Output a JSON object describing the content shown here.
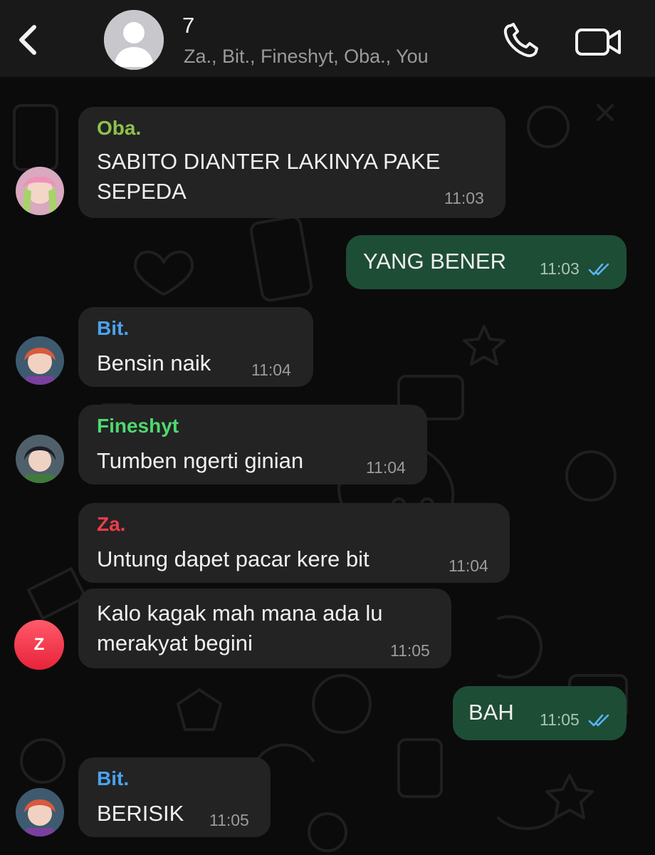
{
  "header": {
    "group_name": "7",
    "members": "Za., Bit., Fineshyt, Oba., You"
  },
  "colors": {
    "incoming_bubble": "#232323",
    "outgoing_bubble": "#1e4d36",
    "oba": "#8fc24a",
    "bit": "#4aa3f0",
    "fineshyt": "#4fd870",
    "za": "#ee3b4b",
    "read_ticks": "#5ab4f5"
  },
  "messages": [
    {
      "sender": "Oba.",
      "lines": [
        "SABITO DIANTER LAKINYA PAKE",
        "SEPEDA"
      ],
      "time": "11:03"
    },
    {
      "sender": "You",
      "lines": [
        "YANG BENER"
      ],
      "time": "11:03",
      "status": "read"
    },
    {
      "sender": "Bit.",
      "lines": [
        "Bensin naik"
      ],
      "time": "11:04"
    },
    {
      "sender": "Fineshyt",
      "lines": [
        "Tumben ngerti ginian"
      ],
      "time": "11:04"
    },
    {
      "sender": "Za.",
      "lines": [
        "Untung dapet pacar kere bit"
      ],
      "time": "11:04"
    },
    {
      "sender": "Za.",
      "lines": [
        "Kalo kagak mah mana ada lu",
        "merakyat begini"
      ],
      "time": "11:05",
      "avatar_letter": "Z"
    },
    {
      "sender": "You",
      "lines": [
        "BAH"
      ],
      "time": "11:05",
      "status": "read"
    },
    {
      "sender": "Bit.",
      "lines": [
        "BERISIK"
      ],
      "time": "11:05"
    }
  ]
}
